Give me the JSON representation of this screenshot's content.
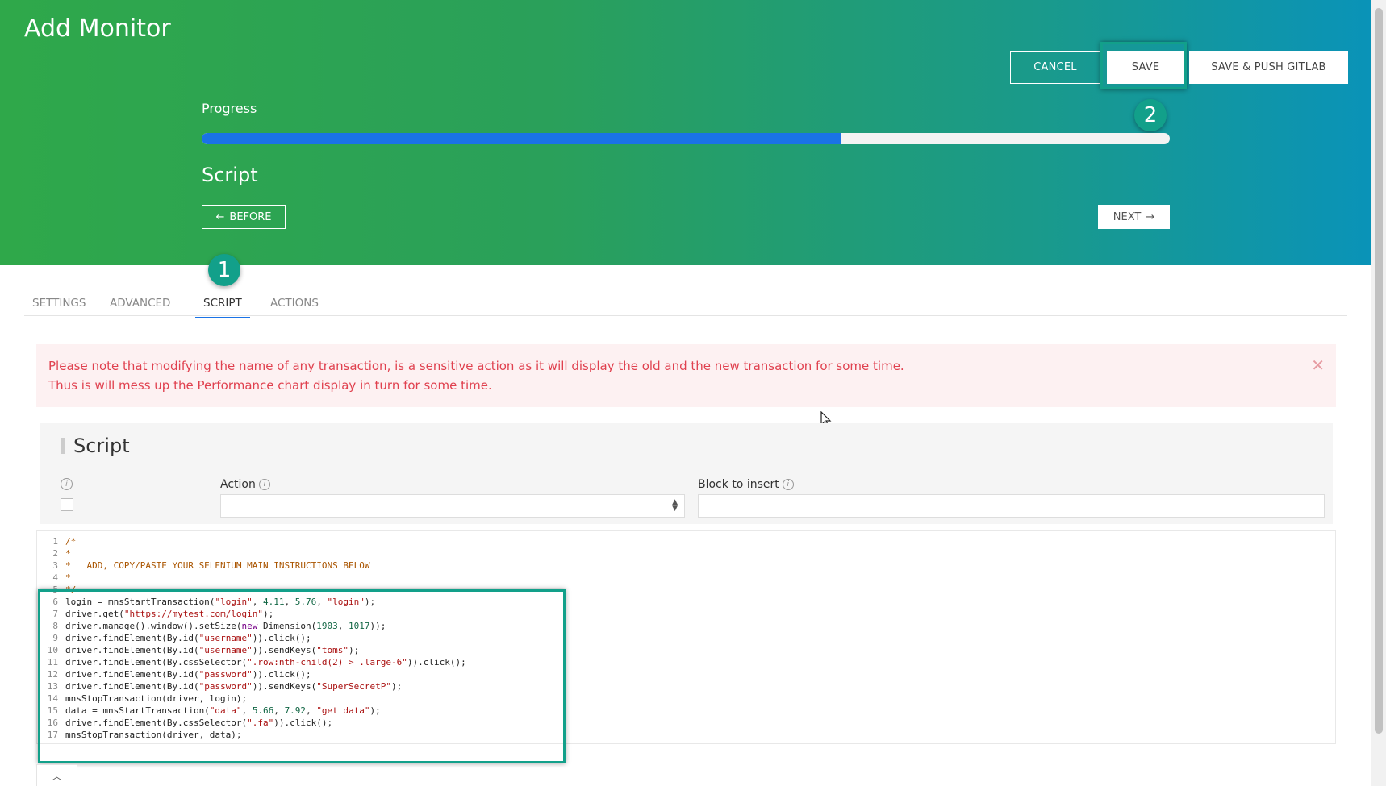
{
  "page": {
    "title": "Add Monitor"
  },
  "toolbar": {
    "cancel_label": "CANCEL",
    "save_label": "SAVE",
    "save_push_label": "SAVE & PUSH GITLAB"
  },
  "annotations": {
    "step1": "1",
    "step2": "2"
  },
  "progress": {
    "label": "Progress",
    "fraction": 0.66
  },
  "section": {
    "title": "Script"
  },
  "nav": {
    "before_label": "BEFORE",
    "next_label": "NEXT"
  },
  "tabs": [
    {
      "label": "SETTINGS",
      "active": false
    },
    {
      "label": "ADVANCED",
      "active": false
    },
    {
      "label": "SCRIPT",
      "active": true
    },
    {
      "label": "ACTIONS",
      "active": false
    }
  ],
  "alert": {
    "line1": "Please note that modifying the name of any transaction, is a sensitive action as it will display the old and the new transaction for some time.",
    "line2": "Thus is will mess up the Performance chart display in turn for some time."
  },
  "script_panel": {
    "heading": "Script",
    "action_label": "Action",
    "action_value": "",
    "block_label": "Block to insert",
    "block_value": ""
  },
  "code_lines": [
    "/*",
    "*",
    "*   ADD, COPY/PASTE YOUR SELENIUM MAIN INSTRUCTIONS BELOW",
    "*",
    "*/",
    "login = mnsStartTransaction(\"login\", 4.11, 5.76, \"login\");",
    "driver.get(\"https://mytest.com/login\");",
    "driver.manage().window().setSize(new Dimension(1903, 1017));",
    "driver.findElement(By.id(\"username\")).click();",
    "driver.findElement(By.id(\"username\")).sendKeys(\"toms\");",
    "driver.findElement(By.cssSelector(\".row:nth-child(2) > .large-6\")).click();",
    "driver.findElement(By.id(\"password\")).click();",
    "driver.findElement(By.id(\"password\")).sendKeys(\"SuperSecretP\");",
    "mnsStopTransaction(driver, login);",
    "data = mnsStartTransaction(\"data\", 5.66, 7.92, \"get data\");",
    "driver.findElement(By.cssSelector(\".fa\")).click();",
    "mnsStopTransaction(driver, data);"
  ],
  "colors": {
    "accent": "#12a08a",
    "progress": "#1a73e6",
    "alert_text": "#e0414f"
  }
}
